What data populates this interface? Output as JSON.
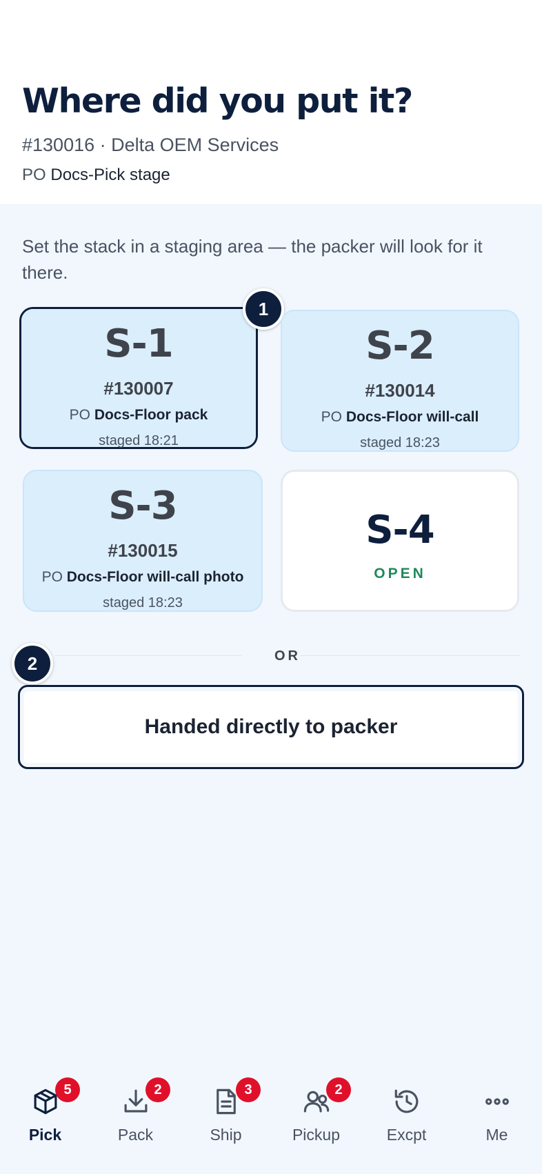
{
  "header": {
    "title": "Where did you put it?",
    "subtitle": "#130016 · Delta OEM Services",
    "po_prefix": "PO",
    "po_value": "Docs-Pick stage"
  },
  "instructions": "Set the stack in a staging area — the packer will look for it there.",
  "step_badges": {
    "step1": "1",
    "step2": "2"
  },
  "slots": [
    {
      "name": "S-1",
      "order": "#130007",
      "po_prefix": "PO",
      "po_value": "Docs-Floor pack",
      "staged": "staged 18:21",
      "selected": true
    },
    {
      "name": "S-2",
      "order": "#130014",
      "po_prefix": "PO",
      "po_value": "Docs-Floor will-call",
      "staged": "staged 18:23",
      "selected": false
    },
    {
      "name": "S-3",
      "order": "#130015",
      "po_prefix": "PO",
      "po_value": "Docs-Floor will-call photo",
      "staged": "staged 18:23",
      "selected": false
    },
    {
      "name": "S-4",
      "status": "OPEN",
      "status_color": "#1f8a5b"
    }
  ],
  "divider_text": "OR",
  "handed_button_label": "Handed directly to packer",
  "nav": [
    {
      "label": "Pick",
      "icon": "box-icon",
      "badge": "5",
      "active": true
    },
    {
      "label": "Pack",
      "icon": "download-icon",
      "badge": "2"
    },
    {
      "label": "Ship",
      "icon": "document-icon",
      "badge": "3"
    },
    {
      "label": "Pickup",
      "icon": "people-icon",
      "badge": "2"
    },
    {
      "label": "Excpt",
      "icon": "history-icon"
    },
    {
      "label": "Me",
      "icon": "more-icon"
    }
  ],
  "colors": {
    "primary_dark": "#0e1f3d",
    "slot_bg": "#dbeefc",
    "badge_red": "#e0102a",
    "page_bg": "#f1f7fd"
  }
}
